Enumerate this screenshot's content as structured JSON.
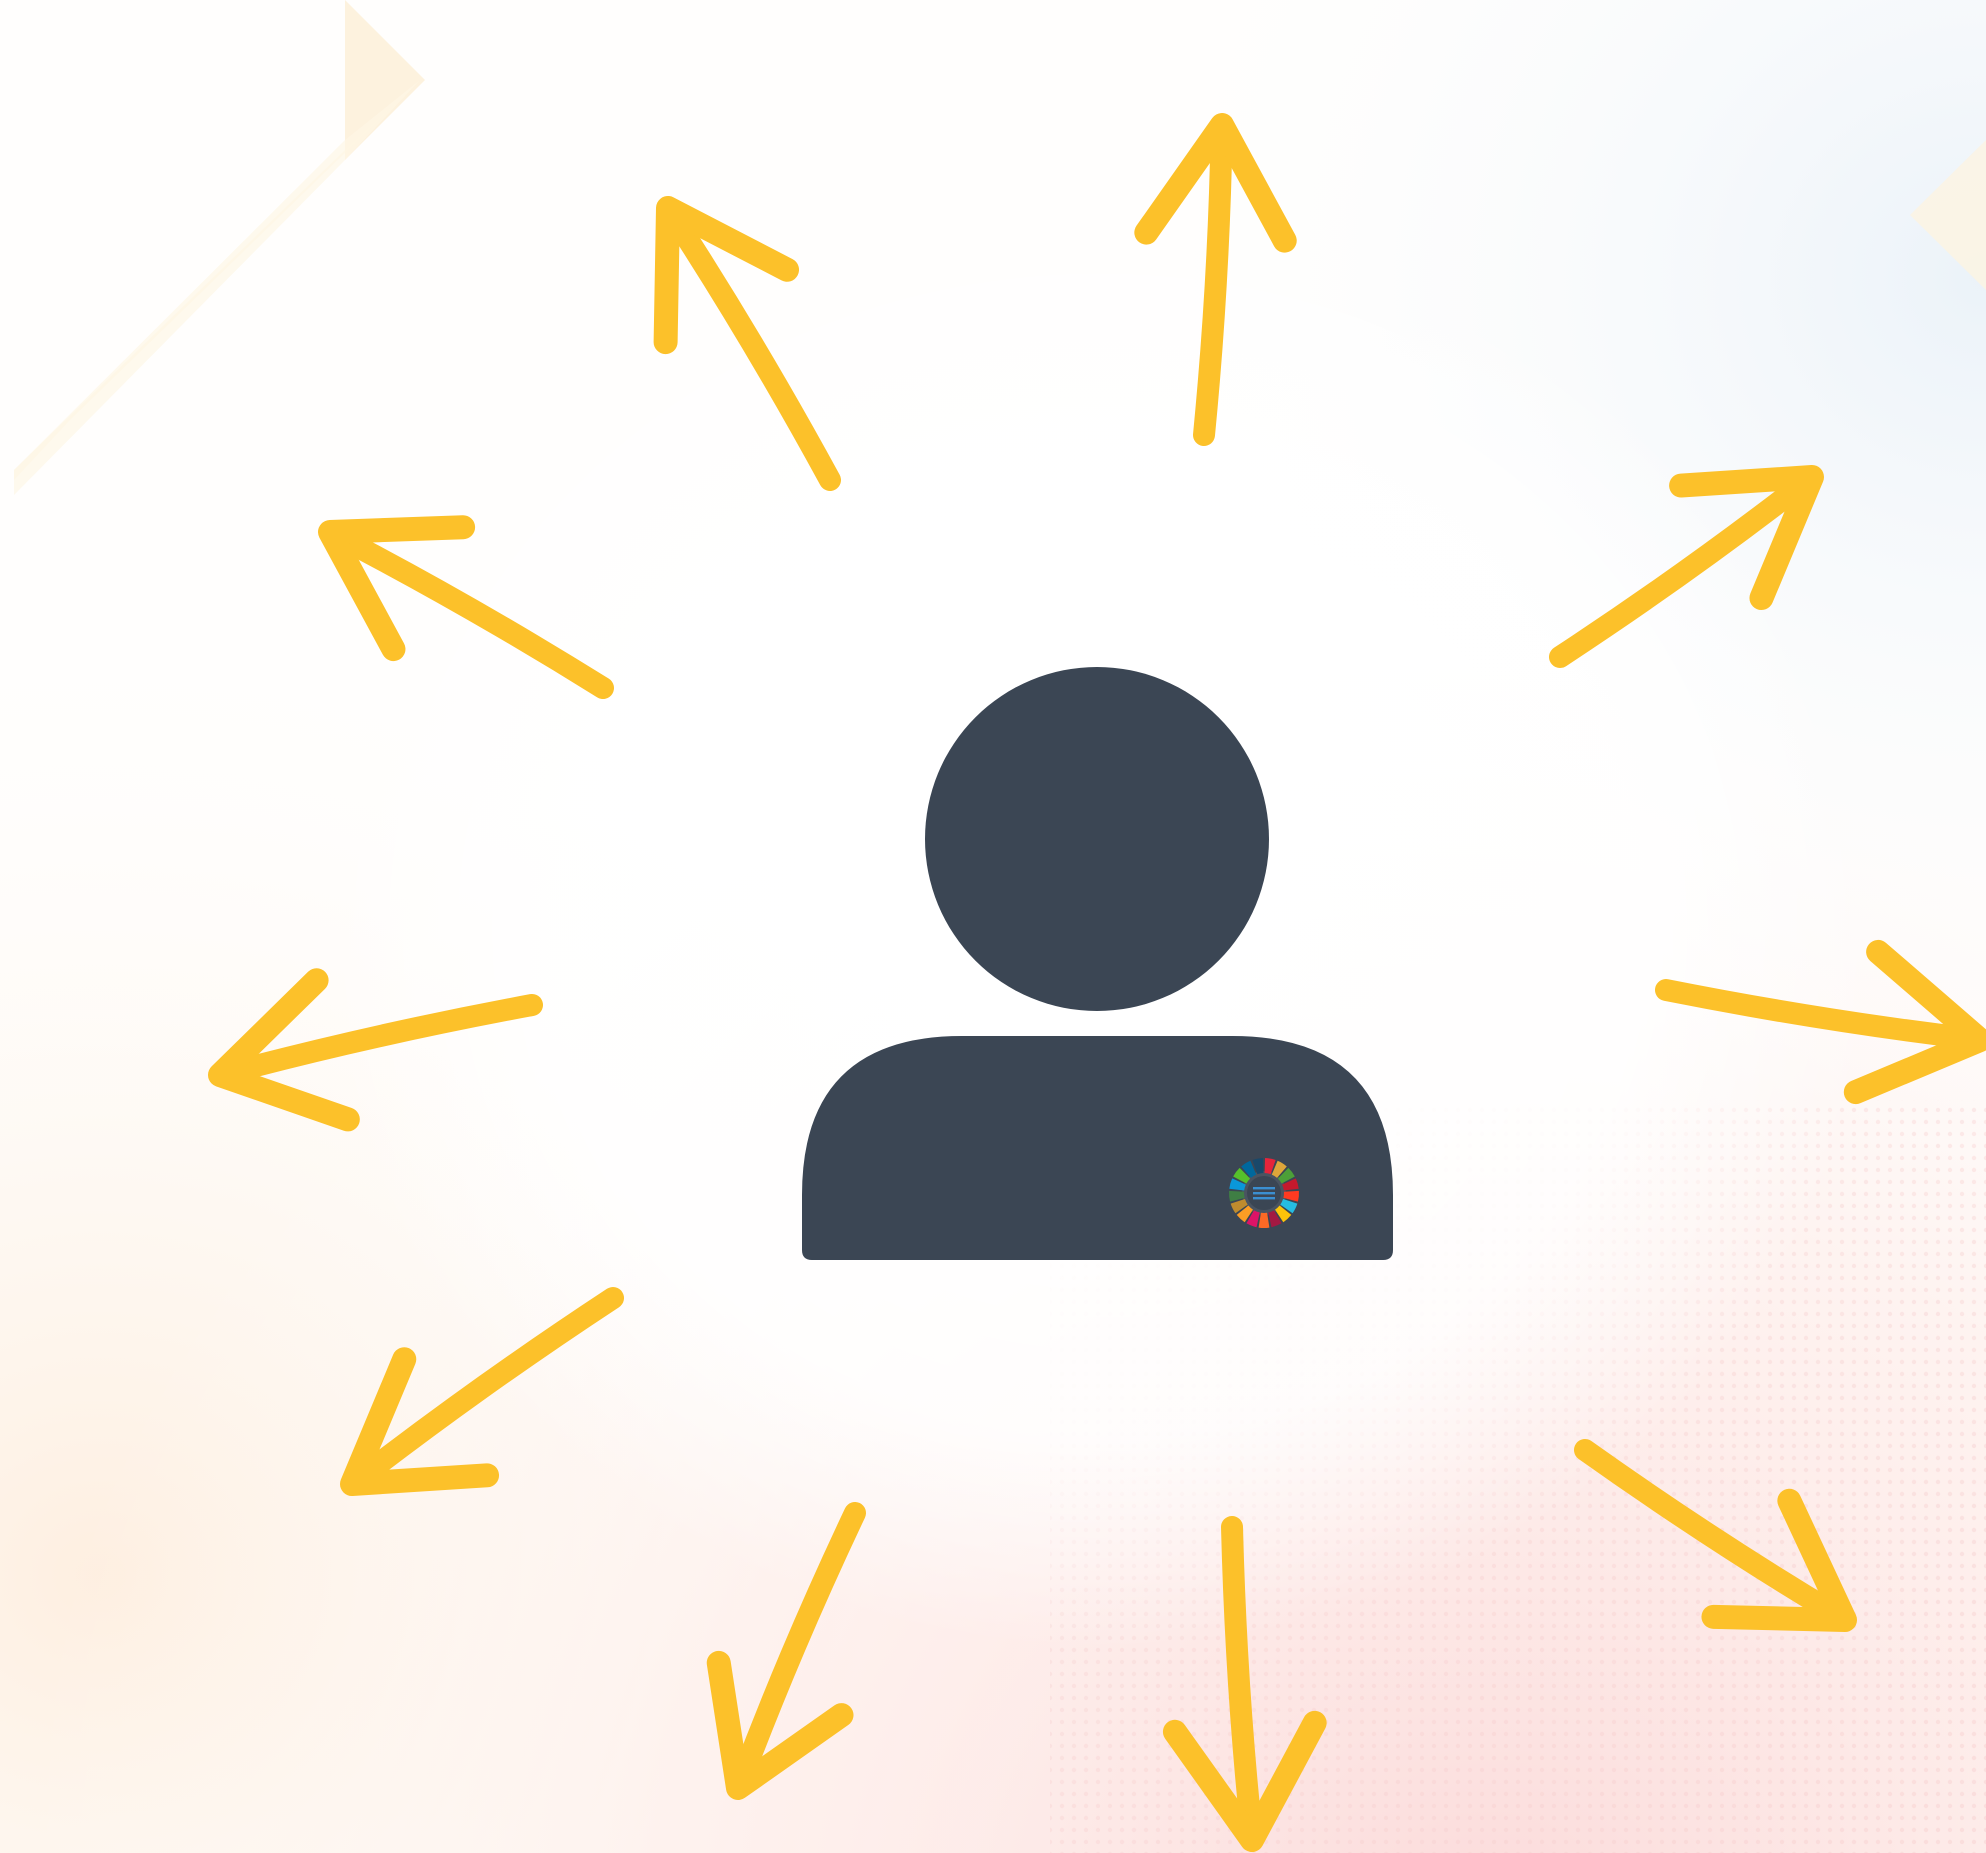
{
  "illustration": {
    "accent_color": "#fcc12a",
    "figure_color": "#3b4654",
    "center_icon": "person-icon",
    "badge_icon": "sdg-wheel-icon",
    "arrow_icon": "hand-drawn-arrow-icon",
    "arrow_count": 10,
    "sdg_wheel_colors": [
      "#e5243b",
      "#dda63a",
      "#4c9f38",
      "#c5192d",
      "#ff3a21",
      "#26bde2",
      "#fcc30b",
      "#a21942",
      "#fd6925",
      "#dd1367",
      "#fd9d24",
      "#bf8b2e",
      "#3f7e44",
      "#0a97d9",
      "#56c02b",
      "#00689d",
      "#19486a"
    ]
  }
}
